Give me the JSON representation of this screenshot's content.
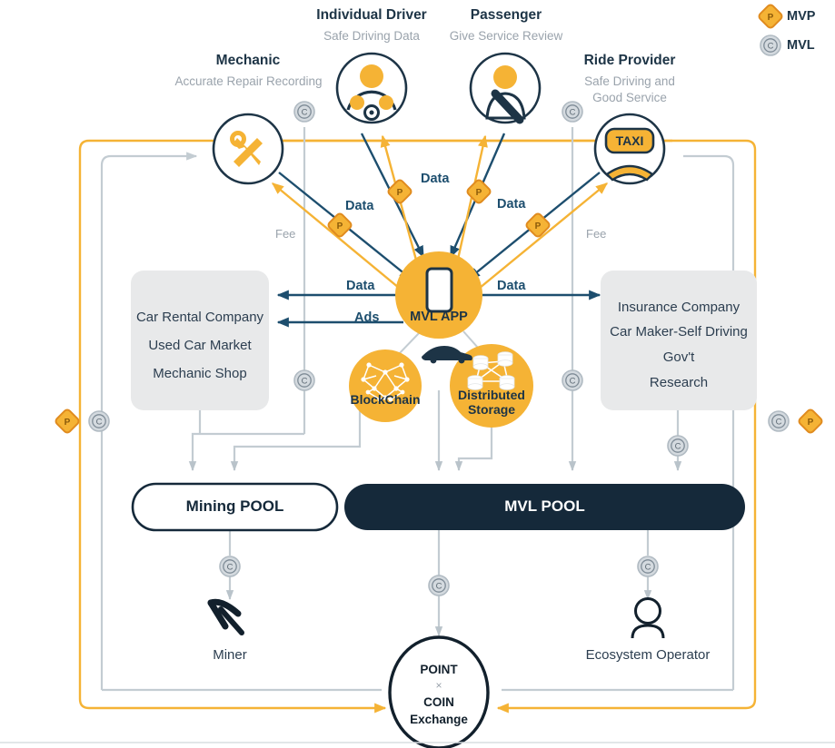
{
  "legend": {
    "items": [
      {
        "glyph": "P",
        "label": "MVP",
        "shape": "diamond-badge",
        "color": "#F5B335"
      },
      {
        "glyph": "C",
        "label": "MVL",
        "shape": "circle-badge",
        "color": "#c3ccd2"
      }
    ]
  },
  "actors": {
    "mechanic": {
      "title": "Mechanic",
      "subtitle": "Accurate Repair Recording",
      "icon": "wrench-screwdriver-icon"
    },
    "individual_driver": {
      "title": "Individual Driver",
      "subtitle": "Safe Driving Data",
      "icon": "driver-steering-wheel-icon"
    },
    "passenger": {
      "title": "Passenger",
      "subtitle": "Give Service Review",
      "icon": "passenger-seatbelt-icon"
    },
    "ride_provider": {
      "title": "Ride Provider",
      "subtitle_line1": "Safe Driving and",
      "subtitle_line2": "Good Service",
      "icon": "taxi-sign-icon"
    }
  },
  "core": {
    "app_label": "MVL APP",
    "app_icon": "smartphone-icon",
    "blockchain_label": "BlockChain",
    "blockchain_icon": "network-graph-icon",
    "storage_label_line1": "Distributed",
    "storage_label_line2": "Storage",
    "storage_icon": "distributed-database-icon",
    "car_icon": "car-icon"
  },
  "left_box": {
    "lines": [
      "Car Rental Company",
      "Used Car Market",
      "Mechanic Shop"
    ]
  },
  "right_box": {
    "lines": [
      "Insurance Company",
      "Car Maker-Self Driving",
      "Gov't",
      "Research"
    ]
  },
  "flows": {
    "data": "Data",
    "ads": "Ads",
    "fee_left": "Fee",
    "fee_right": "Fee"
  },
  "pools": {
    "mining": "Mining POOL",
    "mvl": "MVL POOL"
  },
  "bottom": {
    "miner": {
      "label": "Miner",
      "icon": "pickaxe-icon"
    },
    "operator": {
      "label": "Ecosystem Operator",
      "icon": "person-icon"
    },
    "exchange": {
      "line1": "POINT",
      "x": "×",
      "line2": "COIN",
      "line3": "Exchange"
    }
  },
  "colors": {
    "amber": "#F5B335",
    "navy": "#1d3446",
    "dark_pool": "#15293a",
    "gray_line": "#c3ccd2",
    "gray_text": "#9aa3ac",
    "box_fill": "#e8e9ea",
    "data_arrow": "#1d4e6e"
  }
}
